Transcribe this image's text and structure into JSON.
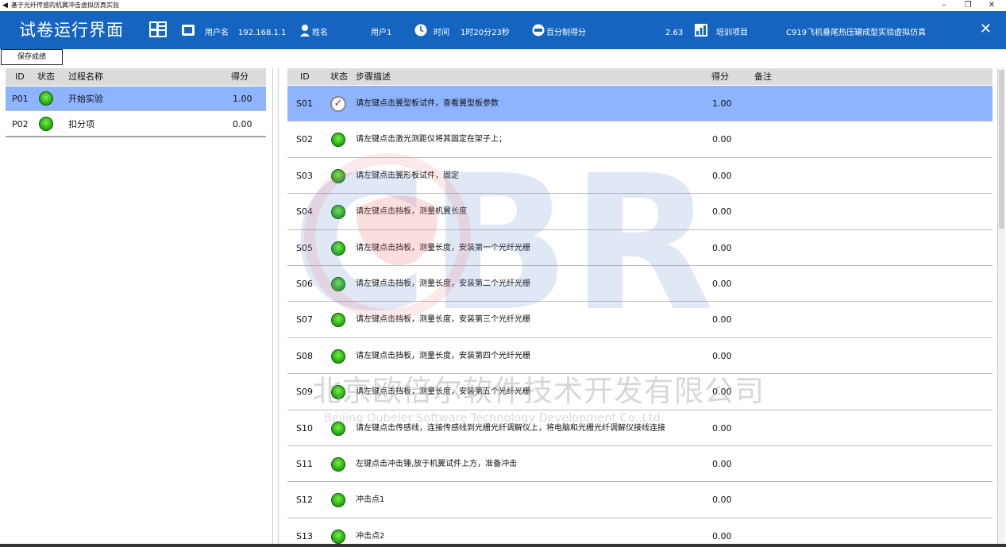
{
  "window": {
    "title": "基于光纤传感的机翼冲击虚拟仿真实验",
    "minimize": "–",
    "restore": "❐",
    "close": "✕"
  },
  "header": {
    "title": "试卷运行界面",
    "ip_label": "用户名",
    "ip_value": "192.168.1.1",
    "name_label": "姓名",
    "user_value": "用户1",
    "time_label": "时间",
    "time_value": "1时20分23秒",
    "score_label": "百分制得分",
    "score_value": "2.63",
    "project_label": "培训项目",
    "project_value": "C919飞机垂尾热压罐成型实验虚拟仿真",
    "close": "✕"
  },
  "toolbar": {
    "save_label": "保存成绩"
  },
  "process_table": {
    "headers": {
      "id": "ID",
      "status": "状态",
      "name": "过程名称",
      "score": "得分"
    },
    "rows": [
      {
        "id": "P01",
        "name": "开始实验",
        "score": "1.00",
        "status": "green",
        "selected": true
      },
      {
        "id": "P02",
        "name": "扣分项",
        "score": "0.00",
        "status": "green",
        "selected": false
      }
    ]
  },
  "step_table": {
    "headers": {
      "id": "ID",
      "status": "状态",
      "desc": "步骤描述",
      "score": "得分",
      "note": "备注"
    },
    "rows": [
      {
        "id": "S01",
        "desc": "请左键点击翼型板试件，查看翼型板参数",
        "score": "1.00",
        "status": "check",
        "selected": true
      },
      {
        "id": "S02",
        "desc": "请左键点击激光测距仪将其固定在架子上；",
        "score": "0.00",
        "status": "green",
        "selected": false
      },
      {
        "id": "S03",
        "desc": "请左键点击翼形板试件，固定",
        "score": "0.00",
        "status": "green",
        "selected": false
      },
      {
        "id": "S04",
        "desc": "请左键点击挡板，测量机翼长度",
        "score": "0.00",
        "status": "green",
        "selected": false
      },
      {
        "id": "S05",
        "desc": "请左键点击挡板，测量长度，安装第一个光纤光栅",
        "score": "0.00",
        "status": "green",
        "selected": false
      },
      {
        "id": "S06",
        "desc": "请左键点击挡板，测量长度，安装第二个光纤光栅",
        "score": "0.00",
        "status": "green",
        "selected": false
      },
      {
        "id": "S07",
        "desc": "请左键点击挡板，测量长度，安装第三个光纤光栅",
        "score": "0.00",
        "status": "green",
        "selected": false
      },
      {
        "id": "S08",
        "desc": "请左键点击挡板，测量长度，安装第四个光纤光栅",
        "score": "0.00",
        "status": "green",
        "selected": false
      },
      {
        "id": "S09",
        "desc": "请左键点击挡板，测量长度，安装第五个光纤光栅",
        "score": "0.00",
        "status": "green",
        "selected": false
      },
      {
        "id": "S10",
        "desc": "请左键点击传感线，连接传感线到光栅光纤调解仪上，将电脑和光栅光纤调解仪接线连接",
        "score": "0.00",
        "status": "green",
        "selected": false
      },
      {
        "id": "S11",
        "desc": "左键点击冲击锤,放于机翼试件上方，准备冲击",
        "score": "0.00",
        "status": "green",
        "selected": false
      },
      {
        "id": "S12",
        "desc": "冲击点1",
        "score": "0.00",
        "status": "green",
        "selected": false
      },
      {
        "id": "S13",
        "desc": "冲击点2",
        "score": "0.00",
        "status": "green",
        "selected": false
      }
    ]
  },
  "watermark": {
    "logo": "CBR",
    "company_cn": "北京欧倍尔软件技术开发有限公司",
    "company_en": "Beijing Oubeier Software Technology Development Co.,Ltd."
  },
  "colors": {
    "header_bg": "#1565c0",
    "selected_row": "#8fb4ff",
    "status_green": "#2fb31a"
  }
}
